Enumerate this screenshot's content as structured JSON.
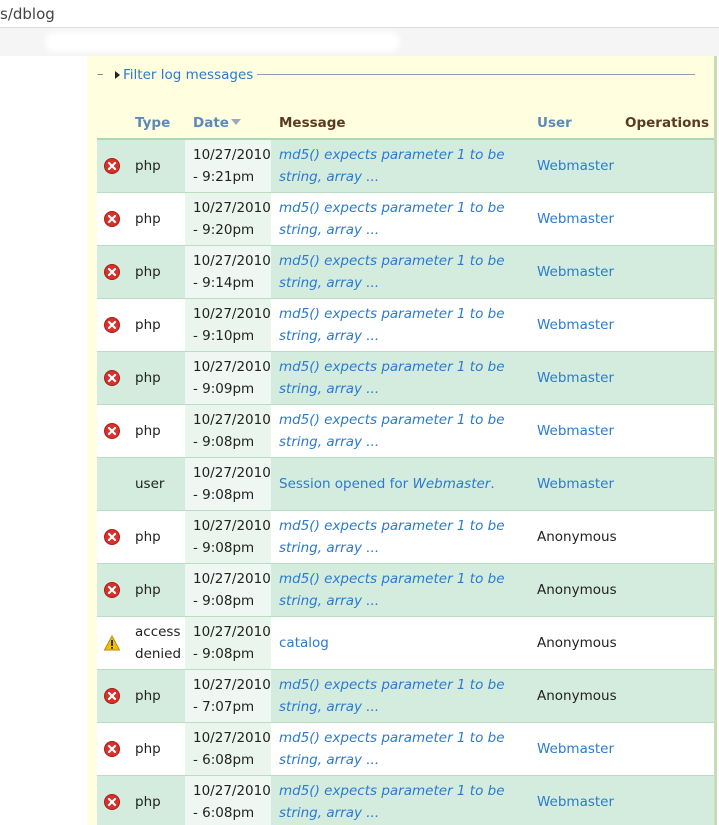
{
  "address_bar": {
    "url": "s/dblog"
  },
  "filter": {
    "legend": "Filter log messages"
  },
  "table": {
    "headers": {
      "type": "Type",
      "date": "Date",
      "message": "Message",
      "user": "User",
      "operations": "Operations"
    },
    "rows": [
      {
        "severity": "error",
        "type": "php",
        "date_line1": "10/27/2010",
        "date_line2": "- 9:21pm",
        "msg_italic": "md5() expects parameter 1 to be string, array ...",
        "msg_prefix": "",
        "msg_link": "",
        "msg_suffix": "",
        "user": "Webmaster",
        "user_link": true
      },
      {
        "severity": "error",
        "type": "php",
        "date_line1": "10/27/2010",
        "date_line2": "- 9:20pm",
        "msg_italic": "md5() expects parameter 1 to be string, array ...",
        "msg_prefix": "",
        "msg_link": "",
        "msg_suffix": "",
        "user": "Webmaster",
        "user_link": true
      },
      {
        "severity": "error",
        "type": "php",
        "date_line1": "10/27/2010",
        "date_line2": "- 9:14pm",
        "msg_italic": "md5() expects parameter 1 to be string, array ...",
        "msg_prefix": "",
        "msg_link": "",
        "msg_suffix": "",
        "user": "Webmaster",
        "user_link": true
      },
      {
        "severity": "error",
        "type": "php",
        "date_line1": "10/27/2010",
        "date_line2": "- 9:10pm",
        "msg_italic": "md5() expects parameter 1 to be string, array ...",
        "msg_prefix": "",
        "msg_link": "",
        "msg_suffix": "",
        "user": "Webmaster",
        "user_link": true
      },
      {
        "severity": "error",
        "type": "php",
        "date_line1": "10/27/2010",
        "date_line2": "- 9:09pm",
        "msg_italic": "md5() expects parameter 1 to be string, array ...",
        "msg_prefix": "",
        "msg_link": "",
        "msg_suffix": "",
        "user": "Webmaster",
        "user_link": true
      },
      {
        "severity": "error",
        "type": "php",
        "date_line1": "10/27/2010",
        "date_line2": "- 9:08pm",
        "msg_italic": "md5() expects parameter 1 to be string, array ...",
        "msg_prefix": "",
        "msg_link": "",
        "msg_suffix": "",
        "user": "Webmaster",
        "user_link": true
      },
      {
        "severity": "none",
        "type": "user",
        "date_line1": "10/27/2010",
        "date_line2": "- 9:08pm",
        "msg_italic": "",
        "msg_prefix": "Session opened for ",
        "msg_link": "Webmaster",
        "msg_suffix": ".",
        "user": "Webmaster",
        "user_link": true
      },
      {
        "severity": "error",
        "type": "php",
        "date_line1": "10/27/2010",
        "date_line2": "- 9:08pm",
        "msg_italic": "md5() expects parameter 1 to be string, array ...",
        "msg_prefix": "",
        "msg_link": "",
        "msg_suffix": "",
        "user": "Anonymous",
        "user_link": false
      },
      {
        "severity": "error",
        "type": "php",
        "date_line1": "10/27/2010",
        "date_line2": "- 9:08pm",
        "msg_italic": "md5() expects parameter 1 to be string, array ...",
        "msg_prefix": "",
        "msg_link": "",
        "msg_suffix": "",
        "user": "Anonymous",
        "user_link": false
      },
      {
        "severity": "warning",
        "type": "access denied",
        "date_line1": "10/27/2010",
        "date_line2": "- 9:08pm",
        "msg_italic": "",
        "msg_prefix": "catalog",
        "msg_link": "",
        "msg_suffix": "",
        "user": "Anonymous",
        "user_link": false
      },
      {
        "severity": "error",
        "type": "php",
        "date_line1": "10/27/2010",
        "date_line2": "- 7:07pm",
        "msg_italic": "md5() expects parameter 1 to be string, array ...",
        "msg_prefix": "",
        "msg_link": "",
        "msg_suffix": "",
        "user": "Anonymous",
        "user_link": false
      },
      {
        "severity": "error",
        "type": "php",
        "date_line1": "10/27/2010",
        "date_line2": "- 6:08pm",
        "msg_italic": "md5() expects parameter 1 to be string, array ...",
        "msg_prefix": "",
        "msg_link": "",
        "msg_suffix": "",
        "user": "Webmaster",
        "user_link": true
      },
      {
        "severity": "error",
        "type": "php",
        "date_line1": "10/27/2010",
        "date_line2": "- 6:08pm",
        "msg_italic": "md5() expects parameter 1 to be string, array ...",
        "msg_prefix": "",
        "msg_link": "",
        "msg_suffix": "",
        "user": "Webmaster",
        "user_link": true
      }
    ]
  },
  "icons": {
    "error": "error-icon",
    "warning": "warning-icon",
    "collapse": "triangle-right-icon",
    "sort": "sort-desc-icon"
  },
  "colors": {
    "link": "#2a7ad2",
    "row_even": "#d3ecdd",
    "panel": "#ffffe0",
    "error_red": "#d9302c",
    "warning_yellow": "#f2c200"
  }
}
